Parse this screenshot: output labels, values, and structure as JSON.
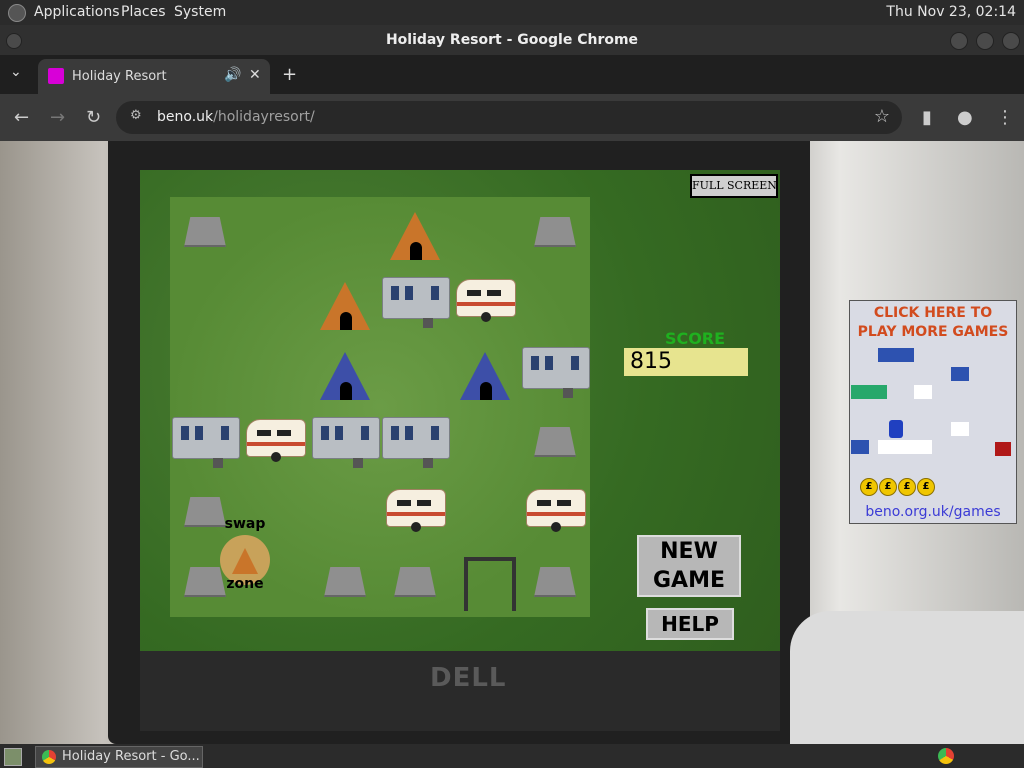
{
  "system_panel": {
    "menus": [
      "Applications",
      "Places",
      "System"
    ],
    "clock": "Thu Nov 23, 02:14"
  },
  "window": {
    "title": "Holiday Resort - Google Chrome"
  },
  "tab": {
    "label": "Holiday Resort",
    "favicon_color": "#d800d8"
  },
  "address_bar": {
    "domain": "beno.uk",
    "path": "/holidayresort/"
  },
  "game": {
    "full_screen_label": "FULL SCREEN",
    "score_label": "SCORE",
    "score": "815",
    "new_game_label": "NEW GAME",
    "new_game_line1": "NEW",
    "new_game_line2": "GAME",
    "help_label": "HELP",
    "swap_label": "swap",
    "zone_label": "zone",
    "grid": [
      [
        "rock",
        "empty",
        "empty",
        "orange-tent",
        "empty",
        "empty",
        "rock"
      ],
      [
        "empty",
        "empty",
        "orange-tent",
        "static-caravan",
        "touring-caravan",
        "empty",
        "empty"
      ],
      [
        "empty",
        "empty",
        "blue-tent",
        "empty",
        "blue-tent",
        "empty",
        "static-caravan"
      ],
      [
        "static-caravan",
        "touring-caravan",
        "static-caravan",
        "static-caravan",
        "empty",
        "empty",
        "rock"
      ],
      [
        "rock",
        "empty",
        "empty",
        "empty",
        "touring-caravan",
        "empty",
        "touring-caravan"
      ],
      [
        "rock",
        "swap-zone",
        "rock",
        "rock",
        "empty",
        "frame",
        "rock"
      ]
    ]
  },
  "ad": {
    "line1": "CLICK HERE TO",
    "line2": "PLAY MORE GAMES",
    "url": "beno.org.uk/games",
    "coin_symbol": "£"
  },
  "taskbar": {
    "window_label": "Holiday Resort - Go..."
  }
}
